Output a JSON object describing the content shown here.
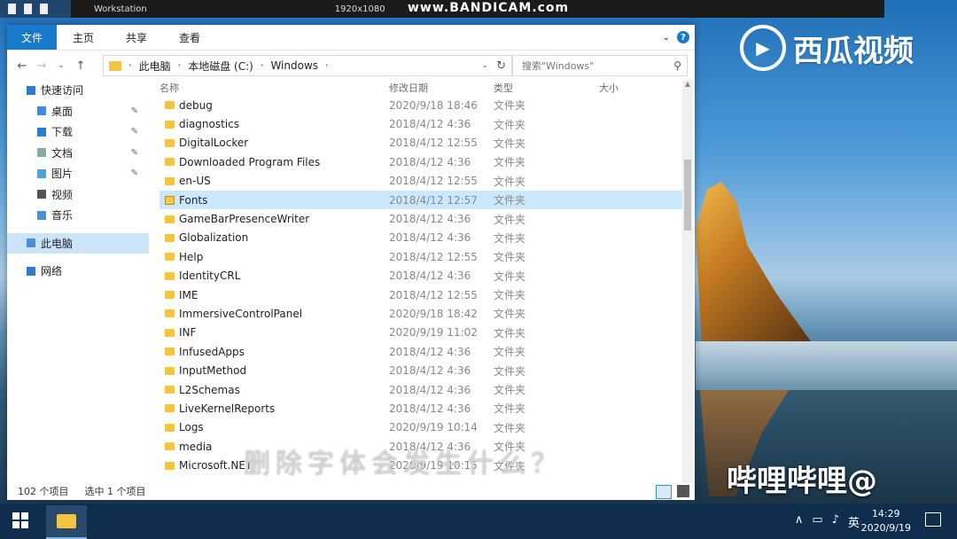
{
  "recorder": {
    "title": "www.BANDICAM.com",
    "tabs": [
      "Workstation",
      "1920x1080"
    ]
  },
  "watermarks": {
    "xigua": "西瓜视频",
    "bilibili": "哔哩哔哩@",
    "subtitle": "删除字体会发生什么？"
  },
  "ribbon": {
    "tabs": [
      "文件",
      "主页",
      "共享",
      "查看"
    ]
  },
  "address": {
    "crumbs": [
      "此电脑",
      "本地磁盘 (C:)",
      "Windows"
    ],
    "search_placeholder": "搜索\"Windows\""
  },
  "sidebar": {
    "items": [
      {
        "label": "快速访问",
        "pinned": false
      },
      {
        "label": "桌面",
        "pinned": true
      },
      {
        "label": "下载",
        "pinned": true
      },
      {
        "label": "文档",
        "pinned": true
      },
      {
        "label": "图片",
        "pinned": true
      },
      {
        "label": "视频",
        "pinned": false
      },
      {
        "label": "音乐",
        "pinned": false
      },
      {
        "label": "此电脑",
        "pinned": false,
        "selected": true
      },
      {
        "label": "网络",
        "pinned": false
      }
    ]
  },
  "columns": {
    "name": "名称",
    "date": "修改日期",
    "type": "类型",
    "size": "大小"
  },
  "files": [
    {
      "name": "debug",
      "date": "2020/9/18 18:46",
      "type": "文件夹"
    },
    {
      "name": "diagnostics",
      "date": "2018/4/12 4:36",
      "type": "文件夹"
    },
    {
      "name": "DigitalLocker",
      "date": "2018/4/12 12:55",
      "type": "文件夹"
    },
    {
      "name": "Downloaded Program Files",
      "date": "2018/4/12 4:36",
      "type": "文件夹"
    },
    {
      "name": "en-US",
      "date": "2018/4/12 12:55",
      "type": "文件夹"
    },
    {
      "name": "Fonts",
      "date": "2018/4/12 12:57",
      "type": "文件夹",
      "selected": true
    },
    {
      "name": "GameBarPresenceWriter",
      "date": "2018/4/12 4:36",
      "type": "文件夹"
    },
    {
      "name": "Globalization",
      "date": "2018/4/12 4:36",
      "type": "文件夹"
    },
    {
      "name": "Help",
      "date": "2018/4/12 12:55",
      "type": "文件夹"
    },
    {
      "name": "IdentityCRL",
      "date": "2018/4/12 4:36",
      "type": "文件夹"
    },
    {
      "name": "IME",
      "date": "2018/4/12 12:55",
      "type": "文件夹"
    },
    {
      "name": "ImmersiveControlPanel",
      "date": "2020/9/18 18:42",
      "type": "文件夹"
    },
    {
      "name": "INF",
      "date": "2020/9/19 11:02",
      "type": "文件夹"
    },
    {
      "name": "InfusedApps",
      "date": "2018/4/12 4:36",
      "type": "文件夹"
    },
    {
      "name": "InputMethod",
      "date": "2018/4/12 4:36",
      "type": "文件夹"
    },
    {
      "name": "L2Schemas",
      "date": "2018/4/12 4:36",
      "type": "文件夹"
    },
    {
      "name": "LiveKernelReports",
      "date": "2018/4/12 4:36",
      "type": "文件夹"
    },
    {
      "name": "Logs",
      "date": "2020/9/19 10:14",
      "type": "文件夹"
    },
    {
      "name": "media",
      "date": "2018/4/12 4:36",
      "type": "文件夹"
    },
    {
      "name": "Microsoft.NET",
      "date": "2020/9/19 10:15",
      "type": "文件夹"
    }
  ],
  "status": {
    "count": "102 个项目",
    "selected": "选中 1 个项目"
  },
  "taskbar": {
    "time": "14:29",
    "date": "2020/9/19",
    "ime": "英"
  }
}
